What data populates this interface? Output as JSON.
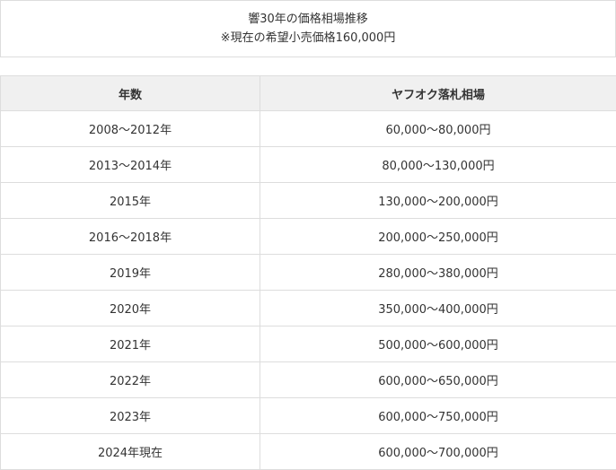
{
  "caption": {
    "line1": "響30年の価格相場推移",
    "line2": "※現在の希望小売価格160,000円"
  },
  "table": {
    "headers": [
      "年数",
      "ヤフオク落札相場"
    ],
    "rows": [
      [
        "2008～2012年",
        "60,000～80,000円"
      ],
      [
        "2013～2014年",
        "80,000～130,000円"
      ],
      [
        "2015年",
        "130,000～200,000円"
      ],
      [
        "2016～2018年",
        "200,000～250,000円"
      ],
      [
        "2019年",
        "280,000～380,000円"
      ],
      [
        "2020年",
        "350,000～400,000円"
      ],
      [
        "2021年",
        "500,000～600,000円"
      ],
      [
        "2022年",
        "600,000～650,000円"
      ],
      [
        "2023年",
        "600,000～750,000円"
      ],
      [
        "2024年現在",
        "600,000～700,000円"
      ]
    ]
  },
  "colors": {
    "header_bg": "#f0f0f0",
    "border": "#dddddd",
    "text": "#333333"
  }
}
